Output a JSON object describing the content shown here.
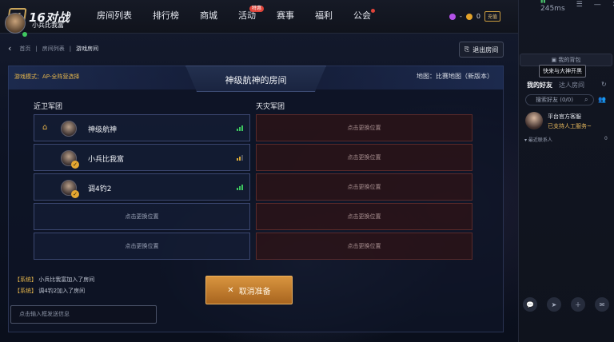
{
  "app": {
    "logo_mark": "K",
    "logo_text": "16对战"
  },
  "nav": {
    "items": [
      {
        "label": "房间列表"
      },
      {
        "label": "排行榜"
      },
      {
        "label": "商城"
      },
      {
        "label": "活动",
        "badge": "特惠"
      },
      {
        "label": "赛事"
      },
      {
        "label": "福利"
      },
      {
        "label": "公会",
        "dot": true
      }
    ]
  },
  "currency": {
    "purple": "-",
    "gold": "0",
    "recharge_label": "充值"
  },
  "window": {
    "ping": "245ms"
  },
  "user": {
    "name": "小兵比我富"
  },
  "sidebar": {
    "backpack_label": "我的背包",
    "tooltip": "快来与大神开黑",
    "tab_friends": "我的好友",
    "tab_nearby": "达人房间",
    "search_placeholder": "搜索好友 (0/0)",
    "service_name": "平台官方客服",
    "service_sub": "已支持人工服务~",
    "recent_label": "▾ 最近联系人",
    "recent_count": "0"
  },
  "breadcrumb": {
    "home": "首页",
    "rooms": "房间列表",
    "current": "游戏房间"
  },
  "exit_label": "退出房间",
  "room": {
    "mode": "游戏模式：AP-全阵营选择",
    "title": "神级航神的房间",
    "map": "地图：比赛地图（新版本）",
    "sentinel_label": "近卫军团",
    "scourge_label": "天灾军团",
    "empty_slot": "点击更换位置",
    "sentinel_slots": [
      {
        "name": "神级航神",
        "host": true,
        "ready": false,
        "signal": 3
      },
      {
        "name": "小兵比我富",
        "host": false,
        "ready": true,
        "signal": 2
      },
      {
        "name": "调4钓2",
        "host": false,
        "ready": true,
        "signal": 3
      }
    ],
    "messages": [
      {
        "tag": "【系统】",
        "text": "小兵比我富加入了房间"
      },
      {
        "tag": "【系统】",
        "text": "调4钓2加入了房间"
      }
    ],
    "chat_placeholder": "点击输入框发送信息",
    "cancel_label": "取消准备"
  },
  "colors": {
    "accent_gold": "#e7b74c",
    "signal_green": "#3cc55f",
    "cancel_orange": "#d9953f"
  }
}
